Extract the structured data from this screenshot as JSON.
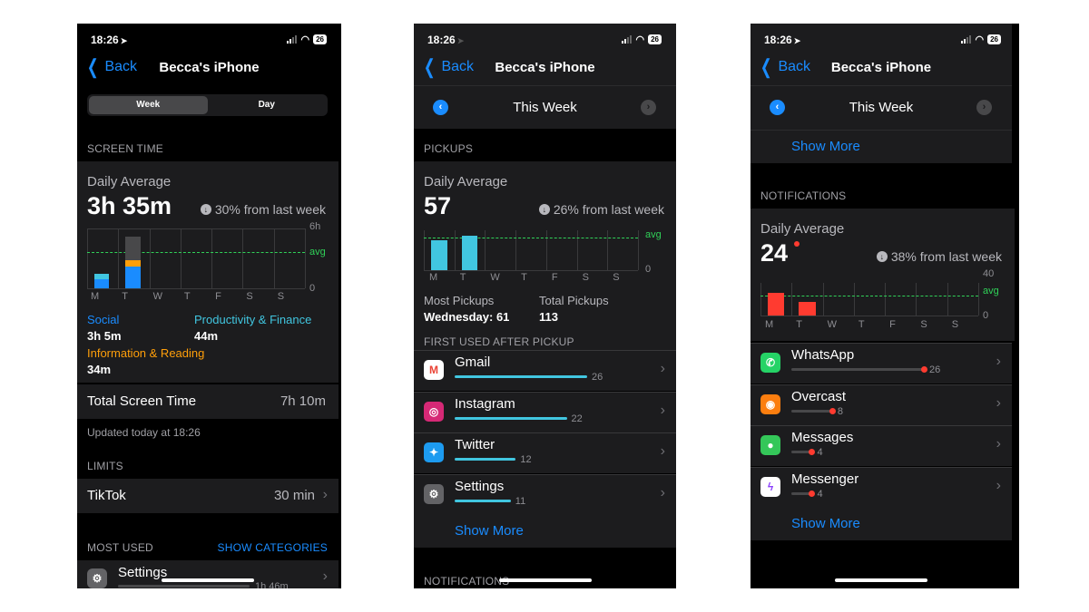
{
  "status": {
    "time": "18:26",
    "battery": "26"
  },
  "nav": {
    "back": "Back",
    "title": "Becca's iPhone"
  },
  "screen1": {
    "segments": [
      "Week",
      "Day"
    ],
    "section_screen_time": "SCREEN TIME",
    "daily_label": "Daily Average",
    "daily_value": "3h 35m",
    "change": "30% from last week",
    "axis_max": "6h",
    "axis_min": "0",
    "avg_label": "avg",
    "days": [
      "M",
      "T",
      "W",
      "T",
      "F",
      "S",
      "S"
    ],
    "categories": [
      {
        "name": "Social",
        "value": "3h 5m",
        "color": "#1a8cff"
      },
      {
        "name": "Productivity & Finance",
        "value": "44m",
        "color": "#41c6e0"
      },
      {
        "name": "Information & Reading",
        "value": "34m",
        "color": "#ff9f0a"
      }
    ],
    "total_label": "Total Screen Time",
    "total_value": "7h 10m",
    "updated": "Updated today at 18:26",
    "section_limits": "LIMITS",
    "limit_app": "TikTok",
    "limit_value": "30 min",
    "section_most_used": "MOST USED",
    "show_categories": "SHOW CATEGORIES",
    "most_used_app": "Settings",
    "most_used_value": "1h 46m"
  },
  "screen2": {
    "week_title": "This Week",
    "section_pickups": "PICKUPS",
    "daily_label": "Daily Average",
    "daily_value": "57",
    "change": "26% from last week",
    "avg_label": "avg",
    "axis_min": "0",
    "days": [
      "M",
      "T",
      "W",
      "T",
      "F",
      "S",
      "S"
    ],
    "most_pickups_label": "Most Pickups",
    "most_pickups_value": "Wednesday: 61",
    "total_pickups_label": "Total Pickups",
    "total_pickups_value": "113",
    "section_first_used": "FIRST USED AFTER PICKUP",
    "apps": [
      {
        "name": "Gmail",
        "count": "26",
        "icon": "gmail-icon"
      },
      {
        "name": "Instagram",
        "count": "22",
        "icon": "instagram-icon"
      },
      {
        "name": "Twitter",
        "count": "12",
        "icon": "twitter-icon"
      },
      {
        "name": "Settings",
        "count": "11",
        "icon": "settings-icon"
      }
    ],
    "show_more": "Show More",
    "section_notifications": "NOTIFICATIONS"
  },
  "screen3": {
    "week_title": "This Week",
    "show_more_top": "Show More",
    "section_notifications": "NOTIFICATIONS",
    "daily_label": "Daily Average",
    "daily_value": "24",
    "change": "38% from last week",
    "axis_max": "40",
    "axis_min": "0",
    "avg_label": "avg",
    "days": [
      "M",
      "T",
      "W",
      "T",
      "F",
      "S",
      "S"
    ],
    "apps": [
      {
        "name": "WhatsApp",
        "count": "26",
        "icon": "whatsapp-icon"
      },
      {
        "name": "Overcast",
        "count": "8",
        "icon": "overcast-icon"
      },
      {
        "name": "Messages",
        "count": "4",
        "icon": "messages-icon"
      },
      {
        "name": "Messenger",
        "count": "4",
        "icon": "messenger-icon"
      }
    ],
    "show_more": "Show More"
  },
  "chart_data": [
    {
      "type": "bar",
      "categories": [
        "M",
        "T",
        "W",
        "T",
        "F",
        "S",
        "S"
      ],
      "series": [
        {
          "name": "Social",
          "values": [
            0.9,
            2.2,
            0,
            0,
            0,
            0,
            0
          ]
        },
        {
          "name": "Productivity & Finance",
          "values": [
            0.6,
            0,
            0,
            0,
            0,
            0,
            0
          ]
        },
        {
          "name": "Information & Reading",
          "values": [
            0,
            0.6,
            0,
            0,
            0,
            0,
            0
          ]
        },
        {
          "name": "Other",
          "values": [
            0,
            2.4,
            0,
            0,
            0,
            0,
            0
          ]
        }
      ],
      "ylim": [
        0,
        6
      ],
      "avg": 3.6
    },
    {
      "type": "bar",
      "categories": [
        "M",
        "T",
        "W",
        "T",
        "F",
        "S",
        "S"
      ],
      "values": [
        52,
        61,
        0,
        0,
        0,
        0,
        0
      ],
      "ylim": [
        0,
        70
      ],
      "avg": 57
    },
    {
      "type": "bar",
      "categories": [
        "M",
        "T",
        "W",
        "T",
        "F",
        "S",
        "S"
      ],
      "values": [
        28,
        17,
        0,
        0,
        0,
        0,
        0
      ],
      "ylim": [
        0,
        40
      ],
      "avg": 24
    }
  ],
  "colors": {
    "accent": "#1a8cff",
    "social": "#1a8cff",
    "productivity": "#41c6e0",
    "reading": "#ff9f0a",
    "other": "#48484a",
    "avg": "#30d158",
    "notif": "#ff3b30"
  }
}
